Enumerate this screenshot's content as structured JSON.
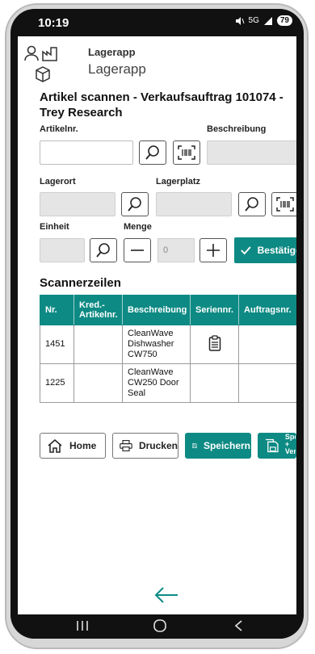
{
  "status_bar": {
    "time": "10:19",
    "network": "5G",
    "battery": "79"
  },
  "header": {
    "app_title_small": "Lagerapp",
    "app_title_large": "Lagerapp"
  },
  "page_title": "Artikel scannen - Verkaufsauftrag 101074 - Trey Research",
  "fields": {
    "item_no_label": "Artikelnr.",
    "item_no_value": "",
    "description_label": "Beschreibung",
    "location_label": "Lagerort",
    "bin_label": "Lagerplatz",
    "unit_label": "Einheit",
    "quantity_label": "Menge",
    "quantity_value": "0"
  },
  "confirm_button": "Bestätigen",
  "scanner_section_title": "Scannerzeilen",
  "table": {
    "headers": [
      "Nr.",
      "Kred.-Artikelnr.",
      "Beschreibung",
      "Seriennr.",
      "Auftragsnr."
    ],
    "rows": [
      {
        "nr": "1451",
        "vendor_item": "",
        "description": "CleanWave Dishwasher CW750",
        "serial": "",
        "order": ""
      },
      {
        "nr": "1225",
        "vendor_item": "",
        "description": "CleanWave CW250 Door Seal",
        "serial": "",
        "order": ""
      }
    ]
  },
  "actions": {
    "home": "Home",
    "print": "Drucken",
    "save": "Speichern",
    "save_and_send": "Speichern + Versenden"
  },
  "colors": {
    "accent": "#0e8a84"
  }
}
